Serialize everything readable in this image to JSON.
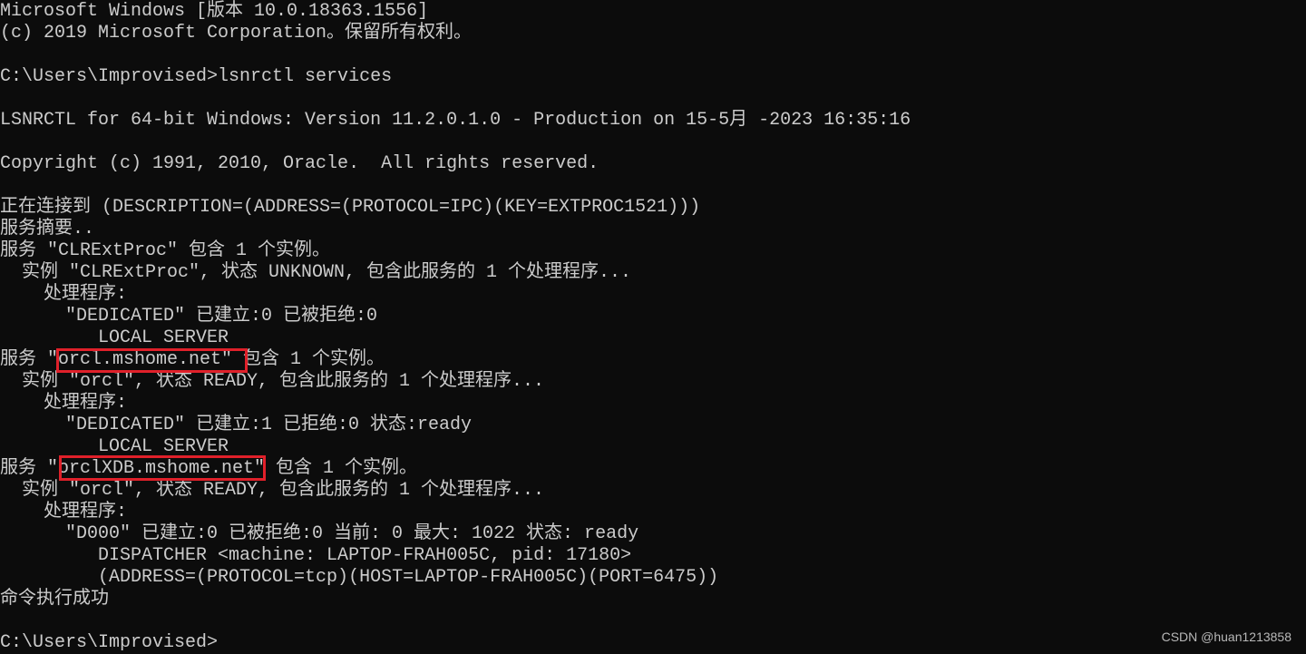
{
  "console": {
    "lines": [
      "Microsoft Windows [版本 10.0.18363.1556]",
      "(c) 2019 Microsoft Corporation。保留所有权利。",
      "",
      "C:\\Users\\Improvised>lsnrctl services",
      "",
      "LSNRCTL for 64-bit Windows: Version 11.2.0.1.0 - Production on 15-5月 -2023 16:35:16",
      "",
      "Copyright (c) 1991, 2010, Oracle.  All rights reserved.",
      "",
      "正在连接到 (DESCRIPTION=(ADDRESS=(PROTOCOL=IPC)(KEY=EXTPROC1521)))",
      "服务摘要..",
      "服务 \"CLRExtProc\" 包含 1 个实例。",
      "  实例 \"CLRExtProc\", 状态 UNKNOWN, 包含此服务的 1 个处理程序...",
      "    处理程序:",
      "      \"DEDICATED\" 已建立:0 已被拒绝:0",
      "         LOCAL SERVER",
      "服务 \"orcl.mshome.net\" 包含 1 个实例。",
      "  实例 \"orcl\", 状态 READY, 包含此服务的 1 个处理程序...",
      "    处理程序:",
      "      \"DEDICATED\" 已建立:1 已拒绝:0 状态:ready",
      "         LOCAL SERVER",
      "服务 \"orclXDB.mshome.net\" 包含 1 个实例。",
      "  实例 \"orcl\", 状态 READY, 包含此服务的 1 个处理程序...",
      "    处理程序:",
      "      \"D000\" 已建立:0 已被拒绝:0 当前: 0 最大: 1022 状态: ready",
      "         DISPATCHER <machine: LAPTOP-FRAH005C, pid: 17180>",
      "         (ADDRESS=(PROTOCOL=tcp)(HOST=LAPTOP-FRAH005C)(PORT=6475))",
      "命令执行成功",
      "",
      "C:\\Users\\Improvised>"
    ]
  },
  "highlights": {
    "color": "#e0202a",
    "items": [
      "orcl.mshome.net",
      "orclXDB.mshome.net"
    ]
  },
  "watermark": "CSDN @huan1213858",
  "colors": {
    "background": "#0c0c0c",
    "text": "#cccccc"
  }
}
